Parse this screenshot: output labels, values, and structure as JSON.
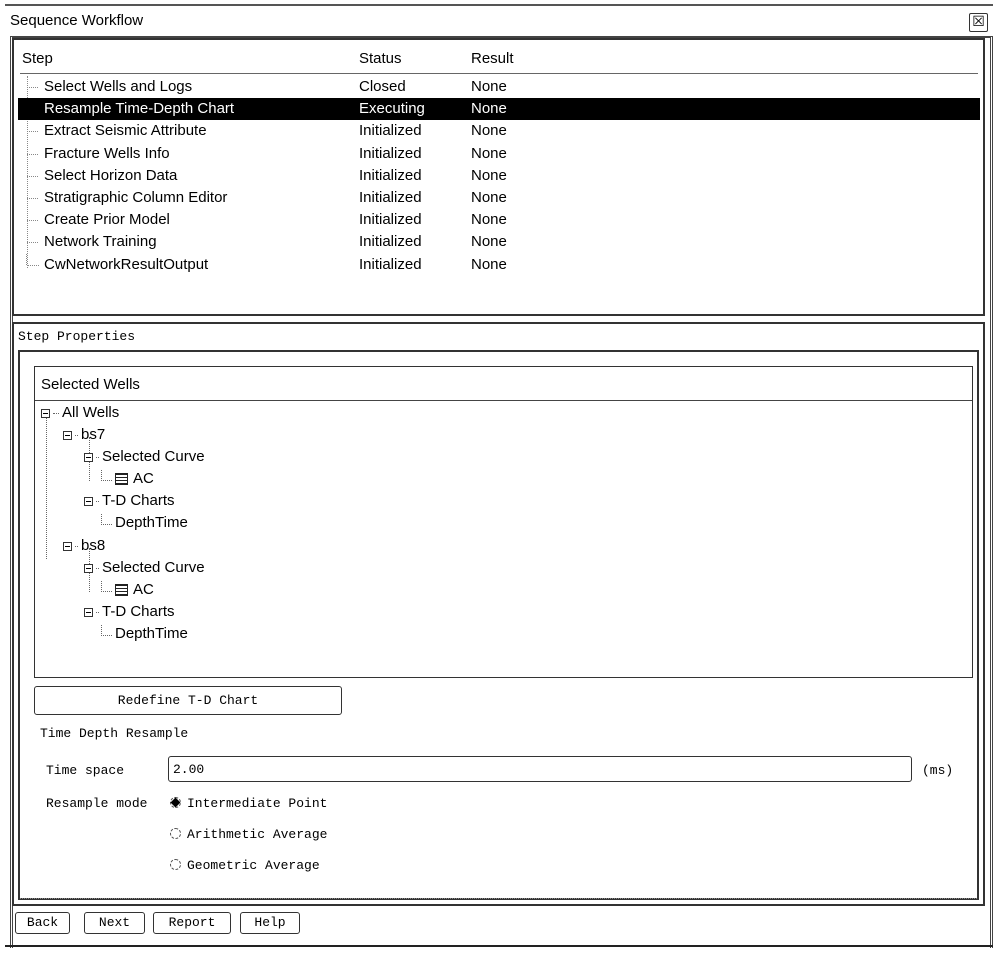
{
  "window": {
    "title": "Sequence Workflow",
    "close_icon": "close-icon"
  },
  "steps_table": {
    "headers": {
      "step": "Step",
      "status": "Status",
      "result": "Result"
    },
    "rows": [
      {
        "step": "Select Wells and Logs",
        "status": "Closed",
        "result": "None",
        "selected": false
      },
      {
        "step": "Resample Time-Depth Chart",
        "status": "Executing",
        "result": "None",
        "selected": true
      },
      {
        "step": "Extract Seismic Attribute",
        "status": "Initialized",
        "result": "None",
        "selected": false
      },
      {
        "step": "Fracture Wells Info",
        "status": "Initialized",
        "result": "None",
        "selected": false
      },
      {
        "step": "Select Horizon Data",
        "status": "Initialized",
        "result": "None",
        "selected": false
      },
      {
        "step": "Stratigraphic Column Editor",
        "status": "Initialized",
        "result": "None",
        "selected": false
      },
      {
        "step": "Create Prior Model",
        "status": "Initialized",
        "result": "None",
        "selected": false
      },
      {
        "step": "Network Training",
        "status": "Initialized",
        "result": "None",
        "selected": false
      },
      {
        "step": "CwNetworkResultOutput",
        "status": "Initialized",
        "result": "None",
        "selected": false
      }
    ]
  },
  "step_properties": {
    "title": "Step Properties",
    "selected_wells": {
      "title": "Selected Wells",
      "root": "All Wells",
      "wells": [
        {
          "name": "bs7",
          "selected_curve_label": "Selected Curve",
          "curve": "AC",
          "td_charts_label": "T-D Charts",
          "td_chart": "DepthTime"
        },
        {
          "name": "bs8",
          "selected_curve_label": "Selected Curve",
          "curve": "AC",
          "td_charts_label": "T-D Charts",
          "td_chart": "DepthTime"
        }
      ]
    },
    "redefine_button": "Redefine T-D Chart",
    "section_label": "Time Depth Resample",
    "time_space": {
      "label": "Time space",
      "value": "2.00",
      "unit": "(ms)"
    },
    "resample_mode": {
      "label": "Resample mode",
      "options": [
        {
          "label": "Intermediate Point",
          "checked": true
        },
        {
          "label": "Arithmetic Average",
          "checked": false
        },
        {
          "label": "Geometric Average",
          "checked": false
        }
      ]
    }
  },
  "footer": {
    "back": "Back",
    "next": "Next",
    "report": "Report",
    "help": "Help"
  }
}
